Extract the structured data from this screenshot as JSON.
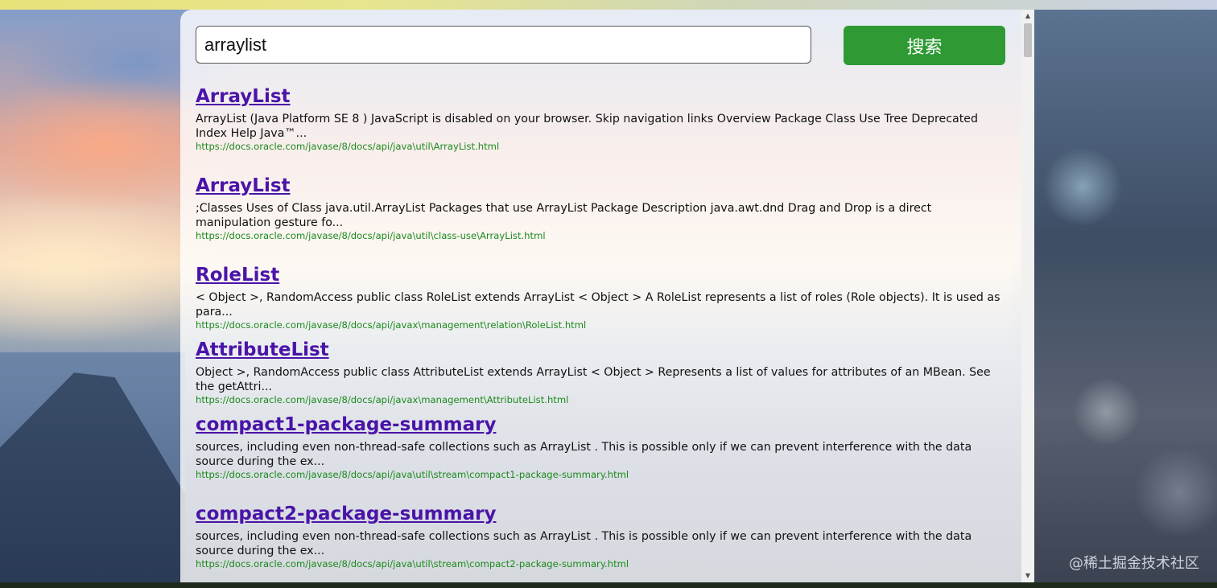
{
  "search": {
    "value": "arraylist",
    "button_label": "搜索"
  },
  "results": [
    {
      "title": "ArrayList",
      "snippet": "ArrayList (Java Platform SE 8 ) JavaScript is disabled on your browser. Skip navigation links Overview Package Class Use Tree Deprecated Index Help Java™...",
      "url": "https://docs.oracle.com/javase/8/docs/api/java\\util\\ArrayList.html"
    },
    {
      "title": "ArrayList",
      "snippet": ";Classes Uses of Class java.util.ArrayList Packages that use ArrayList   Package Description java.awt.dnd Drag and Drop is a direct manipulation gesture fo...",
      "url": "https://docs.oracle.com/javase/8/docs/api/java\\util\\class-use\\ArrayList.html"
    },
    {
      "title": "RoleList",
      "snippet": "< Object >, RandomAccess public class RoleList extends ArrayList < Object > A RoleList represents a list of roles (Role objects). It is used as para...",
      "url": "https://docs.oracle.com/javase/8/docs/api/javax\\management\\relation\\RoleList.html"
    },
    {
      "title": "AttributeList",
      "snippet": "Object >, RandomAccess public class AttributeList extends ArrayList < Object > Represents a list of values for attributes of an MBean. See the getAttri...",
      "url": "https://docs.oracle.com/javase/8/docs/api/javax\\management\\AttributeList.html"
    },
    {
      "title": "compact1-package-summary",
      "snippet": "sources, including even non-thread-safe collections such as ArrayList . This is possible only if we can prevent interference with the data source during the ex...",
      "url": "https://docs.oracle.com/javase/8/docs/api/java\\util\\stream\\compact1-package-summary.html"
    },
    {
      "title": "compact2-package-summary",
      "snippet": "sources, including even non-thread-safe collections such as ArrayList . This is possible only if we can prevent interference with the data source during the ex...",
      "url": "https://docs.oracle.com/javase/8/docs/api/java\\util\\stream\\compact2-package-summary.html"
    }
  ],
  "watermark": "@稀土掘金技术社区",
  "icons": {
    "scroll_up": "arrow-up-icon",
    "scroll_down": "arrow-down-icon"
  },
  "colors": {
    "button_bg": "#2f9a34",
    "title_link": "#4a14a8",
    "url_text": "#1c8a1c"
  }
}
